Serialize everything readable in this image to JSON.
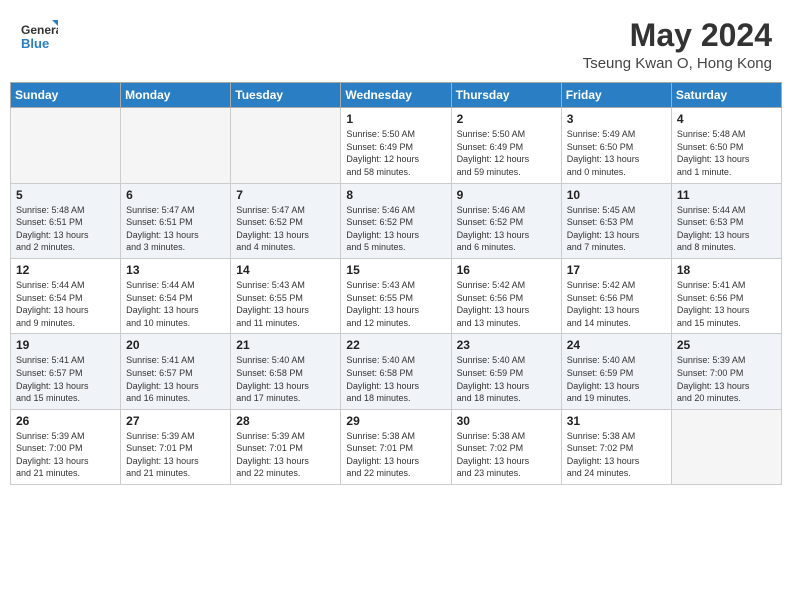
{
  "header": {
    "logo_line1": "General",
    "logo_line2": "Blue",
    "month": "May 2024",
    "location": "Tseung Kwan O, Hong Kong"
  },
  "weekdays": [
    "Sunday",
    "Monday",
    "Tuesday",
    "Wednesday",
    "Thursday",
    "Friday",
    "Saturday"
  ],
  "weeks": [
    [
      {
        "day": "",
        "info": ""
      },
      {
        "day": "",
        "info": ""
      },
      {
        "day": "",
        "info": ""
      },
      {
        "day": "1",
        "info": "Sunrise: 5:50 AM\nSunset: 6:49 PM\nDaylight: 12 hours\nand 58 minutes."
      },
      {
        "day": "2",
        "info": "Sunrise: 5:50 AM\nSunset: 6:49 PM\nDaylight: 12 hours\nand 59 minutes."
      },
      {
        "day": "3",
        "info": "Sunrise: 5:49 AM\nSunset: 6:50 PM\nDaylight: 13 hours\nand 0 minutes."
      },
      {
        "day": "4",
        "info": "Sunrise: 5:48 AM\nSunset: 6:50 PM\nDaylight: 13 hours\nand 1 minute."
      }
    ],
    [
      {
        "day": "5",
        "info": "Sunrise: 5:48 AM\nSunset: 6:51 PM\nDaylight: 13 hours\nand 2 minutes."
      },
      {
        "day": "6",
        "info": "Sunrise: 5:47 AM\nSunset: 6:51 PM\nDaylight: 13 hours\nand 3 minutes."
      },
      {
        "day": "7",
        "info": "Sunrise: 5:47 AM\nSunset: 6:52 PM\nDaylight: 13 hours\nand 4 minutes."
      },
      {
        "day": "8",
        "info": "Sunrise: 5:46 AM\nSunset: 6:52 PM\nDaylight: 13 hours\nand 5 minutes."
      },
      {
        "day": "9",
        "info": "Sunrise: 5:46 AM\nSunset: 6:52 PM\nDaylight: 13 hours\nand 6 minutes."
      },
      {
        "day": "10",
        "info": "Sunrise: 5:45 AM\nSunset: 6:53 PM\nDaylight: 13 hours\nand 7 minutes."
      },
      {
        "day": "11",
        "info": "Sunrise: 5:44 AM\nSunset: 6:53 PM\nDaylight: 13 hours\nand 8 minutes."
      }
    ],
    [
      {
        "day": "12",
        "info": "Sunrise: 5:44 AM\nSunset: 6:54 PM\nDaylight: 13 hours\nand 9 minutes."
      },
      {
        "day": "13",
        "info": "Sunrise: 5:44 AM\nSunset: 6:54 PM\nDaylight: 13 hours\nand 10 minutes."
      },
      {
        "day": "14",
        "info": "Sunrise: 5:43 AM\nSunset: 6:55 PM\nDaylight: 13 hours\nand 11 minutes."
      },
      {
        "day": "15",
        "info": "Sunrise: 5:43 AM\nSunset: 6:55 PM\nDaylight: 13 hours\nand 12 minutes."
      },
      {
        "day": "16",
        "info": "Sunrise: 5:42 AM\nSunset: 6:56 PM\nDaylight: 13 hours\nand 13 minutes."
      },
      {
        "day": "17",
        "info": "Sunrise: 5:42 AM\nSunset: 6:56 PM\nDaylight: 13 hours\nand 14 minutes."
      },
      {
        "day": "18",
        "info": "Sunrise: 5:41 AM\nSunset: 6:56 PM\nDaylight: 13 hours\nand 15 minutes."
      }
    ],
    [
      {
        "day": "19",
        "info": "Sunrise: 5:41 AM\nSunset: 6:57 PM\nDaylight: 13 hours\nand 15 minutes."
      },
      {
        "day": "20",
        "info": "Sunrise: 5:41 AM\nSunset: 6:57 PM\nDaylight: 13 hours\nand 16 minutes."
      },
      {
        "day": "21",
        "info": "Sunrise: 5:40 AM\nSunset: 6:58 PM\nDaylight: 13 hours\nand 17 minutes."
      },
      {
        "day": "22",
        "info": "Sunrise: 5:40 AM\nSunset: 6:58 PM\nDaylight: 13 hours\nand 18 minutes."
      },
      {
        "day": "23",
        "info": "Sunrise: 5:40 AM\nSunset: 6:59 PM\nDaylight: 13 hours\nand 18 minutes."
      },
      {
        "day": "24",
        "info": "Sunrise: 5:40 AM\nSunset: 6:59 PM\nDaylight: 13 hours\nand 19 minutes."
      },
      {
        "day": "25",
        "info": "Sunrise: 5:39 AM\nSunset: 7:00 PM\nDaylight: 13 hours\nand 20 minutes."
      }
    ],
    [
      {
        "day": "26",
        "info": "Sunrise: 5:39 AM\nSunset: 7:00 PM\nDaylight: 13 hours\nand 21 minutes."
      },
      {
        "day": "27",
        "info": "Sunrise: 5:39 AM\nSunset: 7:01 PM\nDaylight: 13 hours\nand 21 minutes."
      },
      {
        "day": "28",
        "info": "Sunrise: 5:39 AM\nSunset: 7:01 PM\nDaylight: 13 hours\nand 22 minutes."
      },
      {
        "day": "29",
        "info": "Sunrise: 5:38 AM\nSunset: 7:01 PM\nDaylight: 13 hours\nand 22 minutes."
      },
      {
        "day": "30",
        "info": "Sunrise: 5:38 AM\nSunset: 7:02 PM\nDaylight: 13 hours\nand 23 minutes."
      },
      {
        "day": "31",
        "info": "Sunrise: 5:38 AM\nSunset: 7:02 PM\nDaylight: 13 hours\nand 24 minutes."
      },
      {
        "day": "",
        "info": ""
      }
    ]
  ]
}
